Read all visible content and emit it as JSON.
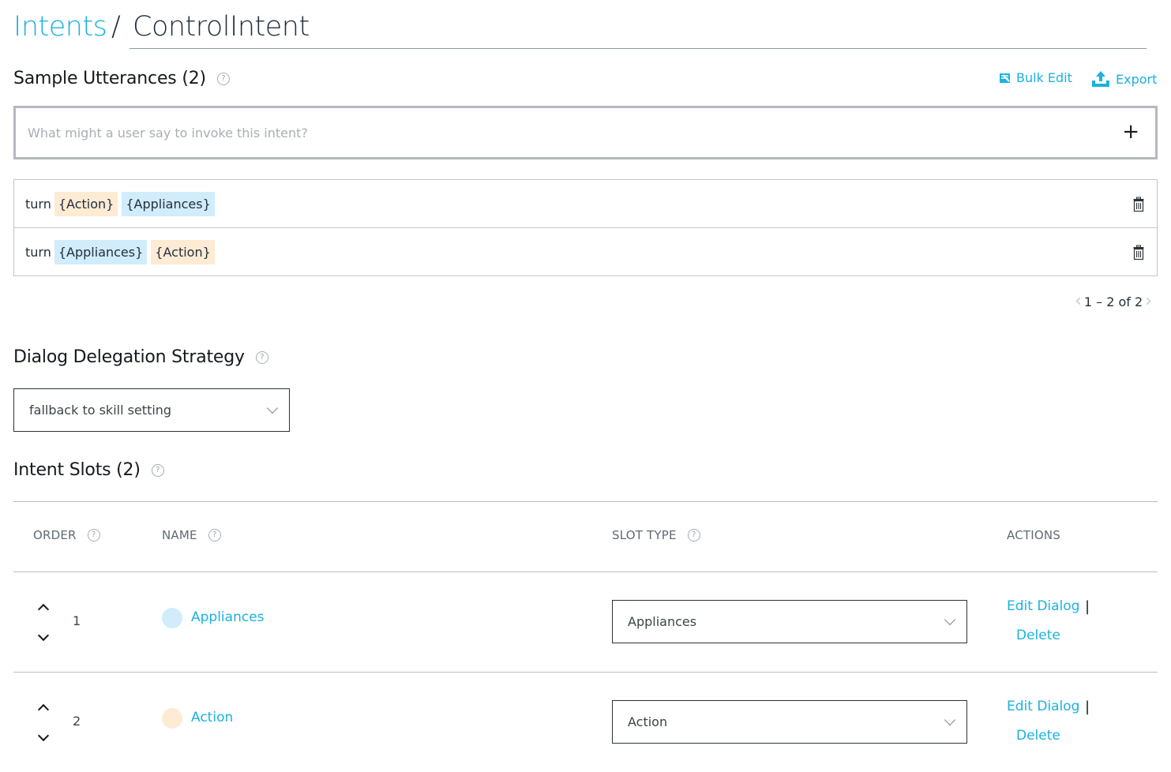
{
  "breadcrumb": {
    "parent": "Intents",
    "separator": "/",
    "current": "ControlIntent"
  },
  "utterances": {
    "title": "Sample Utterances (2)",
    "help": "?",
    "bulk_edit_label": "Bulk Edit",
    "export_label": "Export",
    "input_placeholder": "What might a user say to invoke this intent?",
    "input_value": "",
    "add_symbol": "+",
    "rows": [
      {
        "word": "turn",
        "slots": [
          {
            "text": "{Action}",
            "type": "action"
          },
          {
            "text": "{Appliances}",
            "type": "appliances"
          }
        ]
      },
      {
        "word": "turn",
        "slots": [
          {
            "text": "{Appliances}",
            "type": "appliances"
          },
          {
            "text": "{Action}",
            "type": "action"
          }
        ]
      }
    ],
    "pagination": {
      "prev": "‹",
      "text": "1 – 2 of 2",
      "next": "›"
    }
  },
  "dialog_delegation": {
    "title": "Dialog Delegation Strategy",
    "help": "?",
    "selected": "fallback to skill setting"
  },
  "intent_slots": {
    "title": "Intent Slots (2)",
    "help": "?",
    "columns": {
      "order": "ORDER",
      "name": "NAME",
      "slot_type": "SLOT TYPE",
      "actions": "ACTIONS"
    },
    "rows": [
      {
        "order": "1",
        "name": "Appliances",
        "slot_type": "Appliances",
        "color": "#d1ecfb",
        "edit_label": "Edit Dialog",
        "separator": "|",
        "delete_label": "Delete"
      },
      {
        "order": "2",
        "name": "Action",
        "slot_type": "Action",
        "color": "#fdebd3",
        "edit_label": "Edit Dialog",
        "separator": "|",
        "delete_label": "Delete"
      }
    ]
  },
  "colors": {
    "accent": "#1bb2e0",
    "slot_action": "#fdebd3",
    "slot_appliances": "#d1ecfb"
  }
}
